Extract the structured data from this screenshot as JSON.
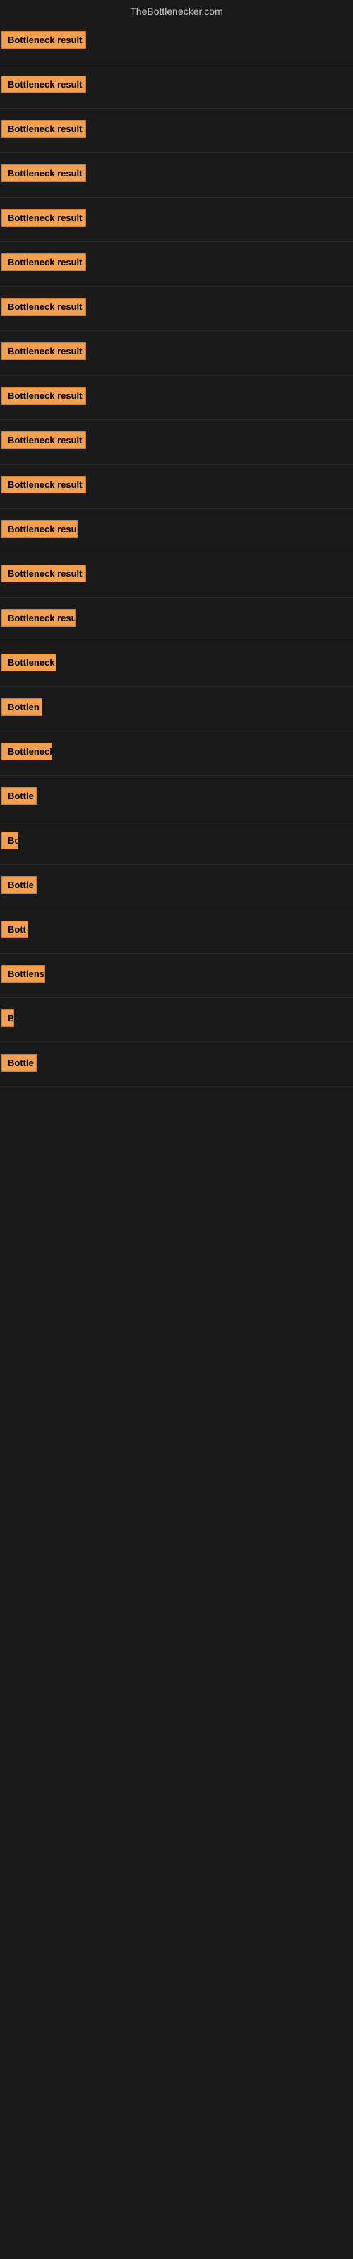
{
  "site": {
    "title": "TheBottlenecker.com"
  },
  "items": [
    {
      "id": 1,
      "label": "Bottleneck result",
      "width": 120
    },
    {
      "id": 2,
      "label": "Bottleneck result",
      "width": 120
    },
    {
      "id": 3,
      "label": "Bottleneck result",
      "width": 120
    },
    {
      "id": 4,
      "label": "Bottleneck result",
      "width": 120
    },
    {
      "id": 5,
      "label": "Bottleneck result",
      "width": 120
    },
    {
      "id": 6,
      "label": "Bottleneck result",
      "width": 120
    },
    {
      "id": 7,
      "label": "Bottleneck result",
      "width": 120
    },
    {
      "id": 8,
      "label": "Bottleneck result",
      "width": 120
    },
    {
      "id": 9,
      "label": "Bottleneck result",
      "width": 120
    },
    {
      "id": 10,
      "label": "Bottleneck result",
      "width": 120
    },
    {
      "id": 11,
      "label": "Bottleneck result",
      "width": 120
    },
    {
      "id": 12,
      "label": "Bottleneck resul",
      "width": 108
    },
    {
      "id": 13,
      "label": "Bottleneck result",
      "width": 120
    },
    {
      "id": 14,
      "label": "Bottleneck resul",
      "width": 105
    },
    {
      "id": 15,
      "label": "Bottleneck r",
      "width": 78
    },
    {
      "id": 16,
      "label": "Bottlen",
      "width": 58
    },
    {
      "id": 17,
      "label": "Bottleneck",
      "width": 72
    },
    {
      "id": 18,
      "label": "Bottle",
      "width": 50
    },
    {
      "id": 19,
      "label": "Bo",
      "width": 24
    },
    {
      "id": 20,
      "label": "Bottle",
      "width": 50
    },
    {
      "id": 21,
      "label": "Bott",
      "width": 38
    },
    {
      "id": 22,
      "label": "Bottlens",
      "width": 62
    },
    {
      "id": 23,
      "label": "B",
      "width": 14
    },
    {
      "id": 24,
      "label": "Bottle",
      "width": 50
    }
  ]
}
